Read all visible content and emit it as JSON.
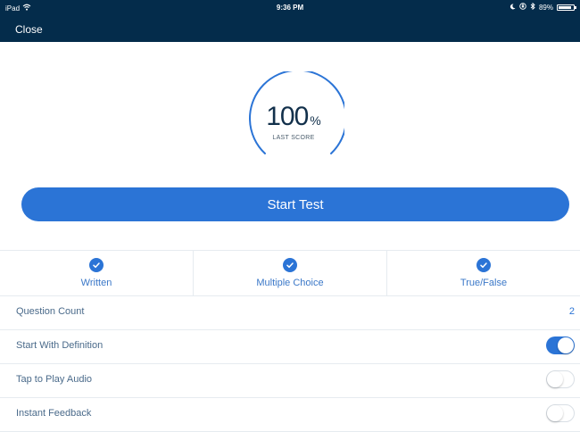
{
  "status_bar": {
    "device": "iPad",
    "time": "9:36 PM",
    "battery": "89%",
    "battery_level": 0.89
  },
  "nav": {
    "close_label": "Close"
  },
  "score": {
    "value": "100",
    "unit": "%",
    "label": "LAST SCORE",
    "fraction": 1.0
  },
  "start_button": {
    "label": "Start Test"
  },
  "question_types": [
    {
      "label": "Written",
      "checked": true
    },
    {
      "label": "Multiple Choice",
      "checked": true
    },
    {
      "label": "True/False",
      "checked": true
    }
  ],
  "settings": {
    "question_count": {
      "label": "Question Count",
      "value": "2"
    },
    "start_with_definition": {
      "label": "Start With Definition",
      "on": true
    },
    "tap_to_play_audio": {
      "label": "Tap to Play Audio",
      "on": false
    },
    "instant_feedback": {
      "label": "Instant Feedback",
      "on": false
    }
  },
  "colors": {
    "header_bg": "#042c4b",
    "accent": "#2b74d6",
    "label_text": "#4a6a8a"
  },
  "icons": [
    "wifi-icon",
    "moon-icon",
    "orientation-lock-icon",
    "bluetooth-icon",
    "battery-icon",
    "checkmark-icon"
  ]
}
